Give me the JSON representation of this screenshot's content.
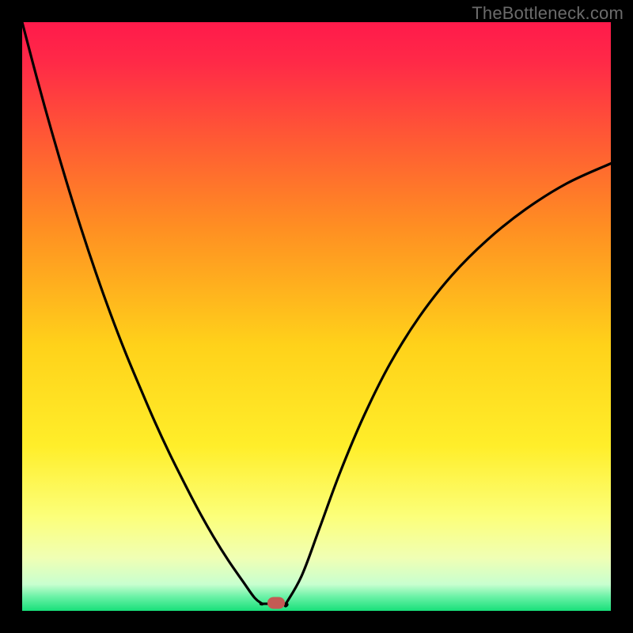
{
  "watermark": "TheBottleneck.com",
  "chart_data": {
    "type": "line",
    "title": "",
    "xlabel": "",
    "ylabel": "",
    "xlim": [
      0,
      1
    ],
    "ylim": [
      0,
      1
    ],
    "gradient_stops": [
      {
        "offset": 0.0,
        "color": "#ff1a4b"
      },
      {
        "offset": 0.07,
        "color": "#ff2a47"
      },
      {
        "offset": 0.2,
        "color": "#ff5a34"
      },
      {
        "offset": 0.35,
        "color": "#ff8f22"
      },
      {
        "offset": 0.55,
        "color": "#ffd21a"
      },
      {
        "offset": 0.72,
        "color": "#ffee2a"
      },
      {
        "offset": 0.84,
        "color": "#fcff7a"
      },
      {
        "offset": 0.91,
        "color": "#f0ffb4"
      },
      {
        "offset": 0.955,
        "color": "#c8ffcf"
      },
      {
        "offset": 0.975,
        "color": "#6ef2a8"
      },
      {
        "offset": 1.0,
        "color": "#18e07a"
      }
    ],
    "series": [
      {
        "name": "left-branch",
        "x": [
          0.0,
          0.025,
          0.05,
          0.075,
          0.1,
          0.125,
          0.15,
          0.175,
          0.2,
          0.225,
          0.25,
          0.275,
          0.3,
          0.325,
          0.35,
          0.375,
          0.395,
          0.408
        ],
        "y": [
          1.0,
          0.905,
          0.815,
          0.73,
          0.65,
          0.575,
          0.505,
          0.44,
          0.38,
          0.322,
          0.268,
          0.218,
          0.17,
          0.126,
          0.086,
          0.05,
          0.022,
          0.012
        ]
      },
      {
        "name": "valley-floor",
        "x": [
          0.408,
          0.448
        ],
        "y": [
          0.012,
          0.012
        ]
      },
      {
        "name": "right-branch",
        "x": [
          0.448,
          0.475,
          0.505,
          0.54,
          0.58,
          0.625,
          0.675,
          0.73,
          0.79,
          0.855,
          0.925,
          1.0
        ],
        "y": [
          0.012,
          0.06,
          0.14,
          0.235,
          0.33,
          0.42,
          0.5,
          0.57,
          0.63,
          0.682,
          0.726,
          0.76
        ]
      }
    ],
    "marker": {
      "x": 0.432,
      "y": 0.013,
      "color": "#c45a54"
    }
  }
}
